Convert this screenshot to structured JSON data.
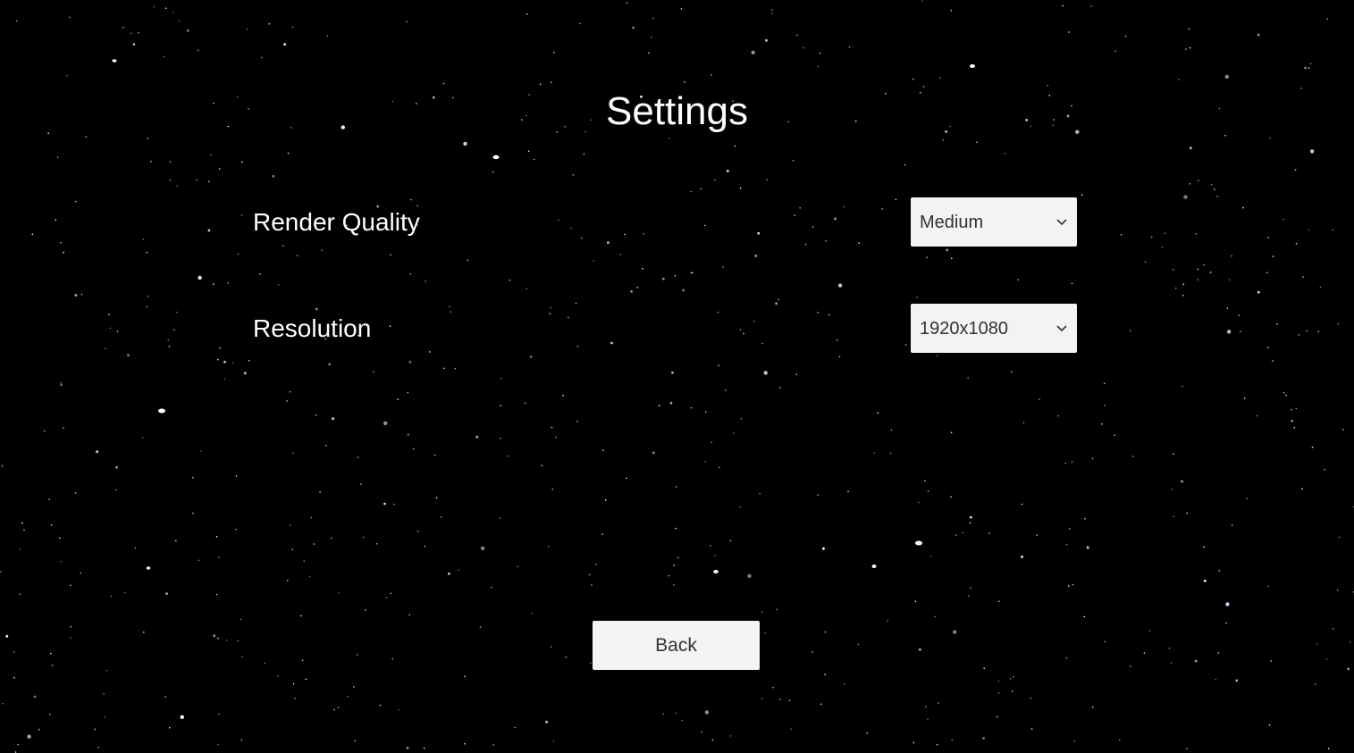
{
  "settings": {
    "title": "Settings",
    "render_quality": {
      "label": "Render Quality",
      "selected": "Medium"
    },
    "resolution": {
      "label": "Resolution",
      "selected": "1920x1080"
    },
    "back_label": "Back"
  },
  "icons": {
    "dropdown": "chevron-down-icon"
  },
  "colors": {
    "background": "#000000",
    "text": "#ffffff",
    "control_background": "#f3f3f3",
    "control_text": "#323232"
  }
}
